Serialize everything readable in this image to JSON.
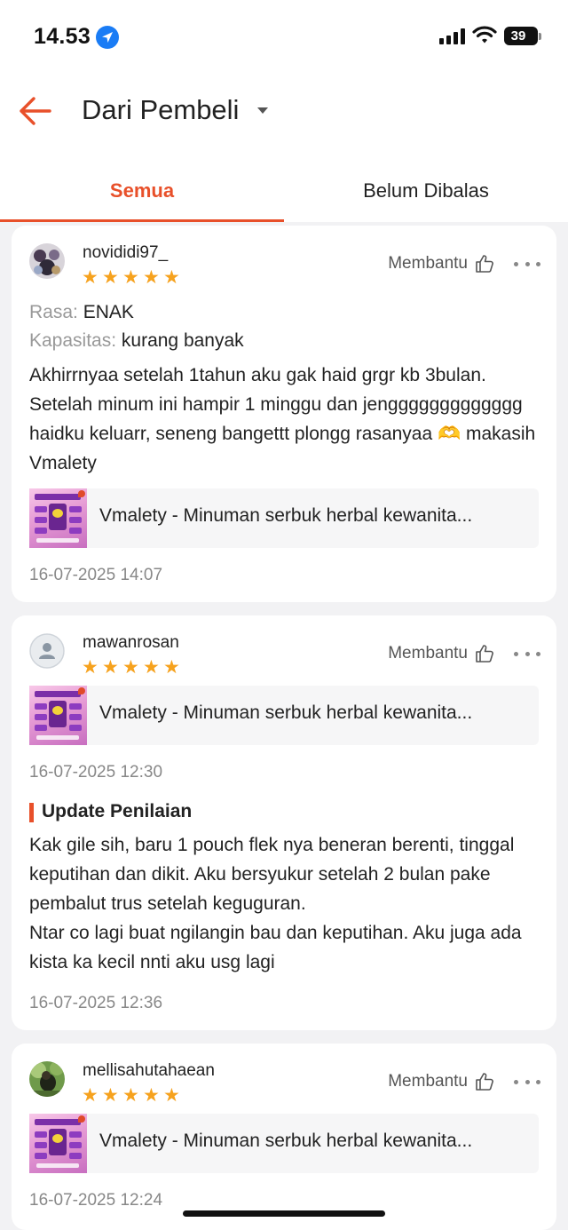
{
  "status_bar": {
    "time": "14.53",
    "battery": "39"
  },
  "header": {
    "title": "Dari Pembeli"
  },
  "tabs": [
    {
      "label": "Semua",
      "active": true
    },
    {
      "label": "Belum Dibalas",
      "active": false
    }
  ],
  "colors": {
    "accent": "#e8502a",
    "star": "#f6a21e",
    "link_blue": "#1a7cf5"
  },
  "helpful_label": "Membantu",
  "reviews": [
    {
      "username": "novididi97_",
      "rating": 5,
      "attr_rasa_key": "Rasa:",
      "attr_rasa_val": "ENAK",
      "attr_kapasitas_key": "Kapasitas:",
      "attr_kapasitas_val": "kurang banyak",
      "text": "Akhirrnyaa setelah 1tahun aku gak haid grgr kb 3bulan. Setelah minum ini hampir 1 minggu dan jenggggggggggggg haidku keluarr, seneng bangettt plongg rasanyaa 🫶 makasih Vmalety",
      "product": "Vmalety - Minuman serbuk herbal kewanita...",
      "timestamp": "16-07-2025 14:07"
    },
    {
      "username": "mawanrosan",
      "rating": 5,
      "product": "Vmalety - Minuman serbuk herbal kewanita...",
      "timestamp": "16-07-2025 12:30",
      "update_label": "Update Penilaian",
      "update_text_1": "Kak gile sih, baru 1 pouch flek nya beneran berenti, tinggal keputihan dan dikit. Aku bersyukur setelah 2 bulan pake pembalut trus setelah keguguran.",
      "update_text_2": "Ntar co lagi buat ngilangin bau dan keputihan. Aku juga ada kista ka kecil nnti aku usg lagi",
      "update_timestamp": "16-07-2025 12:36"
    },
    {
      "username": "mellisahutahaean",
      "rating": 5,
      "product": "Vmalety - Minuman serbuk herbal kewanita...",
      "timestamp": "16-07-2025 12:24"
    }
  ]
}
